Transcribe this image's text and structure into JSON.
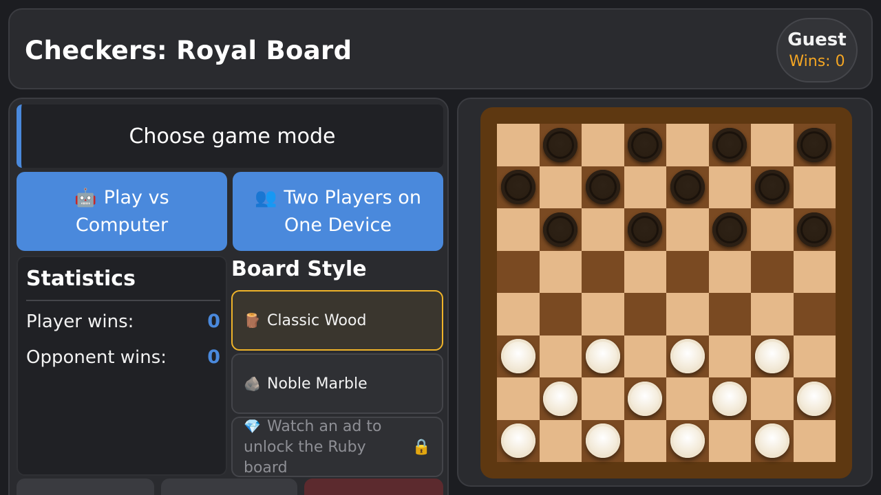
{
  "header": {
    "title": "Checkers: Royal Board",
    "user_name": "Guest",
    "user_wins": "Wins: 0"
  },
  "mode": {
    "title": "Choose game mode",
    "vs_computer": {
      "icon": "robot-icon",
      "label": "Play vs Computer"
    },
    "two_players": {
      "icon": "two-users-icon",
      "label": "Two Players on One Device"
    }
  },
  "stats": {
    "title": "Statistics",
    "player_label": "Player wins:",
    "player_value": "0",
    "opponent_label": "Opponent wins:",
    "opponent_value": "0"
  },
  "board_style": {
    "title": "Board Style",
    "options": [
      {
        "icon": "wood-log-icon",
        "label": "Classic Wood",
        "selected": true
      },
      {
        "icon": "rock-icon",
        "label": "Noble Marble",
        "selected": false
      },
      {
        "icon": "gem-icon",
        "label": "Watch an ad to unlock the Ruby board",
        "locked": true,
        "lock_icon": "lock-icon"
      }
    ]
  },
  "board": {
    "rows": [
      "-b-b-b-b",
      "b-b-b-b-",
      "-b-b-b-b",
      "--------",
      "--------",
      "w-w-w-w-",
      "-w-w-w-w",
      "w-w-w-w-"
    ],
    "colors": {
      "light": "#e5b98a",
      "dark": "#7a4a22",
      "frame": "#5e3811",
      "accent": "#4a89dc",
      "selected_border": "#f0b429",
      "wins_color": "#f5a623"
    }
  }
}
